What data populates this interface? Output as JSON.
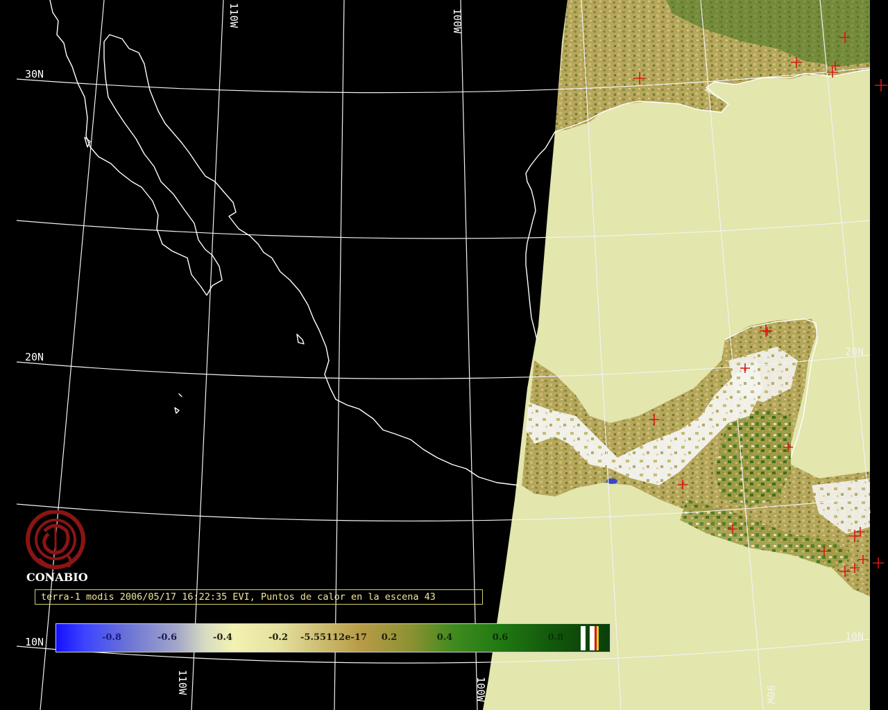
{
  "grid_labels": {
    "lat_30n": "30N",
    "lat_20n_left": "20N",
    "lat_20n_right": "20N",
    "lat_10n_left": "10N",
    "lat_10n_right": "10N",
    "lon_110w_top": "110W",
    "lon_100w_top": "100W",
    "lon_110w_bottom": "110W",
    "lon_100w_bottom": "100W",
    "lon_90w_bottom": "90W"
  },
  "logo": {
    "name": "CONABIO",
    "color": "#8b1414"
  },
  "caption": "terra-1 modis 2006/05/17 16:22:35 EVI, Puntos de calor en la escena 43",
  "colorbar": {
    "ticks": [
      {
        "label": "-0.8",
        "value": -0.8,
        "color": "#1a1a80"
      },
      {
        "label": "-0.6",
        "value": -0.6,
        "color": "#1a1a50"
      },
      {
        "label": "-0.4",
        "value": -0.4,
        "color": "#202010"
      },
      {
        "label": "-0.2",
        "value": -0.2,
        "color": "#202010"
      },
      {
        "label": "-5.55112e-17",
        "value": 0,
        "color": "#202010"
      },
      {
        "label": "0.2",
        "value": 0.2,
        "color": "#202010"
      },
      {
        "label": "0.4",
        "value": 0.4,
        "color": "#0e2a08"
      },
      {
        "label": "0.6",
        "value": 0.6,
        "color": "#0e2a08"
      },
      {
        "label": "0.8",
        "value": 0.8,
        "color": "#0a3508"
      }
    ]
  },
  "colors": {
    "ocean_swath": "#e4e8ac",
    "hotspot": "#d81818",
    "coastline": "#ffffff",
    "graticule": "#ffffff",
    "background": "#000000"
  }
}
